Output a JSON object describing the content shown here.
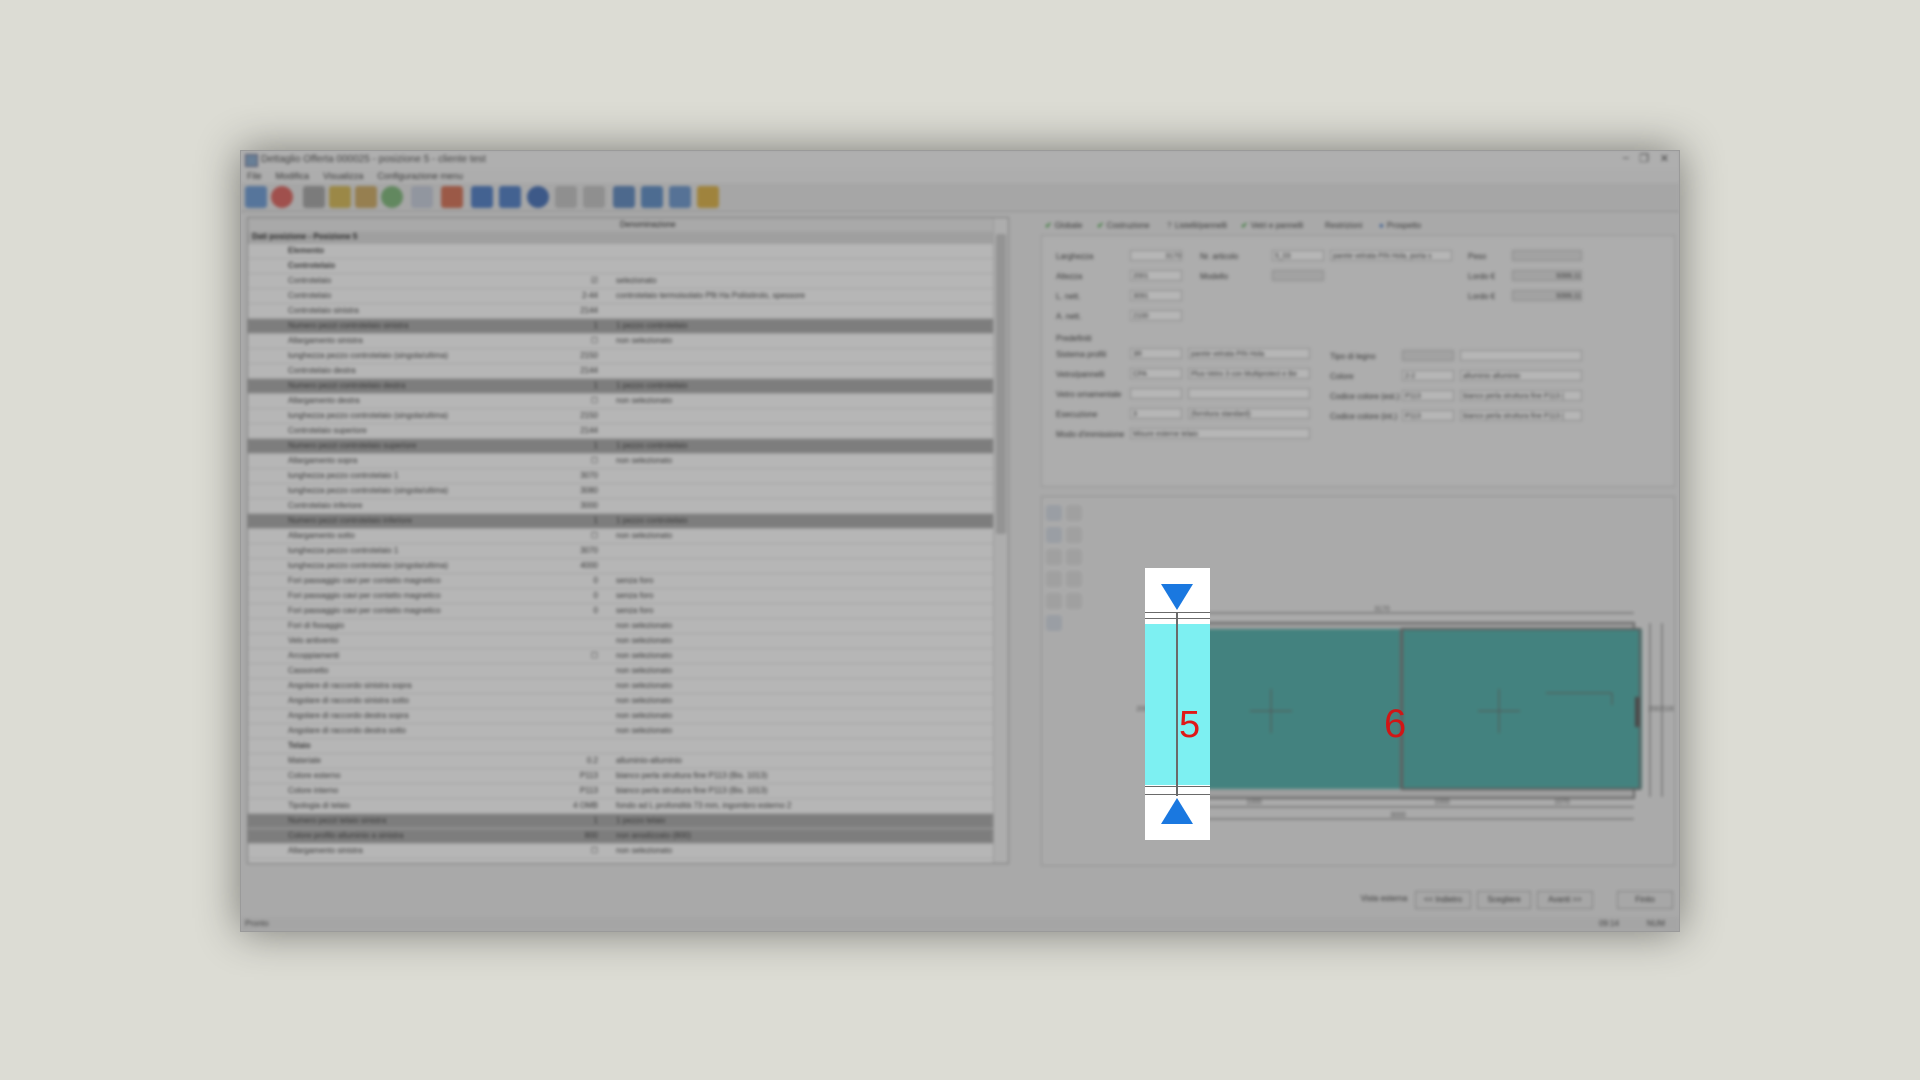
{
  "window": {
    "title": "Dettaglio Offerta 000025 - posizione 5 - cliente test",
    "minimize": "–",
    "maximize": "❐",
    "close": "✕"
  },
  "menu": [
    "File",
    "Modifica",
    "Visualizza",
    "Configurazione menu"
  ],
  "toolbar_icons": [
    "globe-icon",
    "stop-icon",
    "pencil-icon",
    "wand-icon",
    "wand2-icon",
    "palette-icon",
    "document-icon",
    "pin-icon",
    "first-icon",
    "prev-icon",
    "dot-icon",
    "next-icon",
    "last-icon",
    "grid-icon",
    "chart-icon",
    "image-icon",
    "bug-icon"
  ],
  "left": {
    "header_col": "Denominazione",
    "section": "Dati posizione - Posizione 5",
    "rows": [
      {
        "c1": "Elemento",
        "c2": "",
        "c3": "",
        "dark": false,
        "bold": true
      },
      {
        "c1": "Controtelaio",
        "c2": "",
        "c3": "",
        "dark": false,
        "bold": true
      },
      {
        "c1": "Controtelaio",
        "c2": "☑",
        "c3": "selezionato",
        "dark": false
      },
      {
        "c1": "Controtelaio",
        "c2": "2-44",
        "c3": "controtelaio termoisolato Pfit Ha Poliistirolo, spessore",
        "dark": false
      },
      {
        "c1": "Controtelaio sinistra",
        "c2": "2144",
        "c3": "",
        "dark": false
      },
      {
        "c1": "Numero pezzi controtelaio sinistra",
        "c2": "1",
        "c3": "1 pezzo controtelaio",
        "dark": true
      },
      {
        "c1": "Allargamento sinistra",
        "c2": "☐",
        "c3": "non selezionato",
        "dark": false
      },
      {
        "c1": "lunghezza pezzo controtelaio (singola/ultima)",
        "c2": "2150",
        "c3": "",
        "dark": false
      },
      {
        "c1": "Controtelaio destra",
        "c2": "2144",
        "c3": "",
        "dark": false
      },
      {
        "c1": "Numero pezzi controtelaio destra",
        "c2": "1",
        "c3": "1 pezzo controtelaio",
        "dark": true
      },
      {
        "c1": "Allargamento destra",
        "c2": "☐",
        "c3": "non selezionato",
        "dark": false
      },
      {
        "c1": "lunghezza pezzo controtelaio (singola/ultima)",
        "c2": "2150",
        "c3": "",
        "dark": false
      },
      {
        "c1": "Controtelaio superiore",
        "c2": "2144",
        "c3": "",
        "dark": false
      },
      {
        "c1": "Numero pezzi controtelaio superiore",
        "c2": "1",
        "c3": "1 pezzo controtelaio",
        "dark": true
      },
      {
        "c1": "Allargamento sopra",
        "c2": "☐",
        "c3": "non selezionato",
        "dark": false
      },
      {
        "c1": "lunghezza pezzo controtelaio 1",
        "c2": "3070",
        "c3": "",
        "dark": false
      },
      {
        "c1": "lunghezza pezzo controtelaio (singola/ultima)",
        "c2": "3080",
        "c3": "",
        "dark": false
      },
      {
        "c1": "Controtelaio inferiore",
        "c2": "3000",
        "c3": "",
        "dark": false
      },
      {
        "c1": "Numero pezzi controtelaio inferiore",
        "c2": "1",
        "c3": "1 pezzo controtelaio",
        "dark": true
      },
      {
        "c1": "Allargamento sotto",
        "c2": "☐",
        "c3": "non selezionato",
        "dark": false
      },
      {
        "c1": "lunghezza pezzo controtelaio 1",
        "c2": "3070",
        "c3": "",
        "dark": false
      },
      {
        "c1": "lunghezza pezzo controtelaio (singola/ultima)",
        "c2": "4000",
        "c3": "",
        "dark": false
      },
      {
        "c1": "Fori passaggio cavi per contatto magnetico",
        "c2": "0",
        "c3": "senza foro",
        "dark": false
      },
      {
        "c1": "Fori passaggio cavi per contatto magnetico",
        "c2": "0",
        "c3": "senza foro",
        "dark": false
      },
      {
        "c1": "Fori passaggio cavi per contatto magnetico",
        "c2": "0",
        "c3": "senza foro",
        "dark": false
      },
      {
        "c1": "Fori di fissaggio",
        "c2": "",
        "c3": "non selezionato",
        "dark": false
      },
      {
        "c1": "Velo antivento",
        "c2": "",
        "c3": "non selezionato",
        "dark": false
      },
      {
        "c1": "Arcoppiamenti",
        "c2": "☐",
        "c3": "non selezionato",
        "dark": false
      },
      {
        "c1": "Cassonetto",
        "c2": "",
        "c3": "non selezionato",
        "dark": false
      },
      {
        "c1": "Angolare di raccordo sinistra sopra",
        "c2": "",
        "c3": "non selezionato",
        "dark": false
      },
      {
        "c1": "Angolare di raccordo sinistra sotto",
        "c2": "",
        "c3": "non selezionato",
        "dark": false
      },
      {
        "c1": "Angolare di raccordo destra sopra",
        "c2": "",
        "c3": "non selezionato",
        "dark": false
      },
      {
        "c1": "Angolare di raccordo destra sotto",
        "c2": "",
        "c3": "non selezionato",
        "dark": false
      },
      {
        "c1": "Telaio",
        "c2": "",
        "c3": "",
        "dark": false,
        "bold": true
      },
      {
        "c1": "Materiale",
        "c2": "0.2",
        "c3": "alluminio-alluminio",
        "dark": false
      },
      {
        "c1": "Colore esterno",
        "c2": "P113",
        "c3": "bianco perla struttura fine P113 (Bis. 1013)",
        "dark": false
      },
      {
        "c1": "Colore interno",
        "c2": "P113",
        "c3": "bianco perla struttura fine P113 (Bis. 1013)",
        "dark": false
      },
      {
        "c1": "Tipologia di telaio",
        "c2": "4 OMB",
        "c3": "fondo ad L profondità 73 mm, ingombro esterno 2",
        "dark": false
      },
      {
        "c1": "Numero pezzi telaio sinistra",
        "c2": "1",
        "c3": "1 pezzo telaio",
        "dark": true
      },
      {
        "c1": "Colore profilo alluminio a sinistra",
        "c2": "800",
        "c3": "non anodizzato (800)",
        "dark": true
      },
      {
        "c1": "Allargamento sinistra",
        "c2": "☐",
        "c3": "non selezionato",
        "dark": false
      }
    ]
  },
  "tabs": [
    {
      "label": "Globale",
      "mark": "✔"
    },
    {
      "label": "Costruzione",
      "mark": "✔"
    },
    {
      "label": "Listelli/pannelli",
      "mark": "?"
    },
    {
      "label": "Vetri e pannelli",
      "mark": "✔"
    },
    {
      "label": "Restrizioni",
      "mark": ""
    },
    {
      "label": "Prospetto",
      "mark": "●"
    }
  ],
  "form": {
    "larghezza_label": "Larghezza",
    "larghezza": "3170",
    "altezza_label": "Altezza",
    "altezza": "2001",
    "lluce_label": "L. nett.",
    "lluce": "3091",
    "aluce_label": "A. nett.",
    "aluce": "2100",
    "narticolo_label": "Nr. articolo",
    "narticolo": "5_03",
    "narticolo_desc": "parete vetrata PIN Hola, porta s",
    "modello_label": "Modello",
    "peso_label": "Peso",
    "lordo_label": "Lordo €",
    "lordo": "9399,11",
    "lordo2_label": "Lordo €",
    "lordo2": "9399,11",
    "group_label": "Predefiniti",
    "sistema_label": "Sistema profili",
    "sistema": "3R",
    "sistema_desc": "parete vetrata PIN Hola",
    "vetro_label": "Vetro/pannelli",
    "vetro": "CPA",
    "vetro_desc": "Plus-Vetro 3 con Multiprotect e Be",
    "ornamentale_label": "Vetro ornamentale",
    "esecuzione_label": "Esecuzione",
    "esecuzione": "3",
    "esecuzione_desc": "(fornitura standard)",
    "dimensione_label": "Modo d'immissione",
    "dimensione": "Misure esterne telaio",
    "tipo_label": "Tipo di legno",
    "colore_label": "Colore",
    "colore": "2-2",
    "colore_desc": "alluminio alluminio",
    "ce_label": "Codice colore (est.)",
    "ce": "P113",
    "ce_desc": "bianco perla struttura fine P113 (",
    "ci_label": "Codice colore (int.)",
    "ci": "P113",
    "ci_desc": "bianco perla struttura fine P113 ("
  },
  "drawing": {
    "top_dim": "3170",
    "bottom_dims": [
      "1000",
      "1000",
      "1070"
    ],
    "total_dim": "3000",
    "left_dim": "2001",
    "right_dims": [
      "2001",
      "2100"
    ]
  },
  "highlight": {
    "label": "5"
  },
  "sash_label": "6",
  "buttons": {
    "vista": "Vista esterna",
    "indietro": "<< Indietro",
    "scegliere": "Scegliere",
    "avanti": "Avanti >>",
    "fine": "Finito"
  },
  "status": {
    "left": "Pronto",
    "time": "09:14",
    "right": "NUM"
  },
  "colors": {
    "glass": "#3aa6a0",
    "highlight_glass": "#7df0f2",
    "arrow": "#1a78e0",
    "label_red": "#e01818"
  }
}
